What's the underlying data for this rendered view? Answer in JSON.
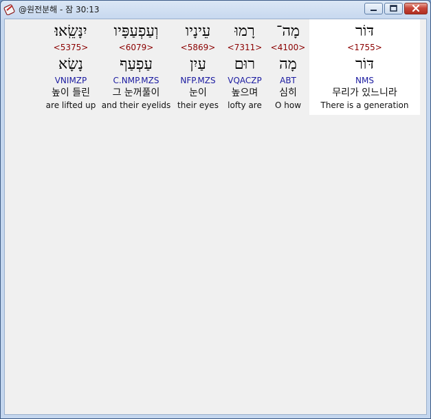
{
  "window": {
    "title": "@원전분해 - 잠 30:13",
    "buttons": {
      "minimize": "minimize",
      "maximize": "maximize",
      "close": "close"
    }
  },
  "words": [
    {
      "hebrew": "יִנָּשֵֽׂאוּ׃",
      "strong": "<5375>",
      "lemma": "נָשָׂא",
      "morph": "VNIMZP",
      "korean": "높이 들린",
      "english": "are lifted up"
    },
    {
      "hebrew": "וְעַפְעַפָּיו",
      "strong": "<6079>",
      "lemma": "עַפְעַף",
      "morph": "C.NMP.MZS",
      "korean": "그 눈꺼풀이",
      "english": "and their eyelids"
    },
    {
      "hebrew": "עֵינָיו",
      "strong": "<5869>",
      "lemma": "עַיִן",
      "morph": "NFP.MZS",
      "korean": "눈이",
      "english": "their eyes"
    },
    {
      "hebrew": "רָמוּ",
      "strong": "<7311>",
      "lemma": "רוּם",
      "morph": "VQACZP",
      "korean": "높으며",
      "english": "lofty are"
    },
    {
      "hebrew": "מָה־",
      "strong": "<4100>",
      "lemma": "מָה",
      "morph": "ABT",
      "korean": "심히",
      "english": "O how"
    },
    {
      "hebrew": "דּוֹר",
      "strong": "<1755>",
      "lemma": "דּוֹר",
      "morph": "NMS",
      "korean": "무리가 있느니라",
      "english": "There is a generation"
    }
  ]
}
